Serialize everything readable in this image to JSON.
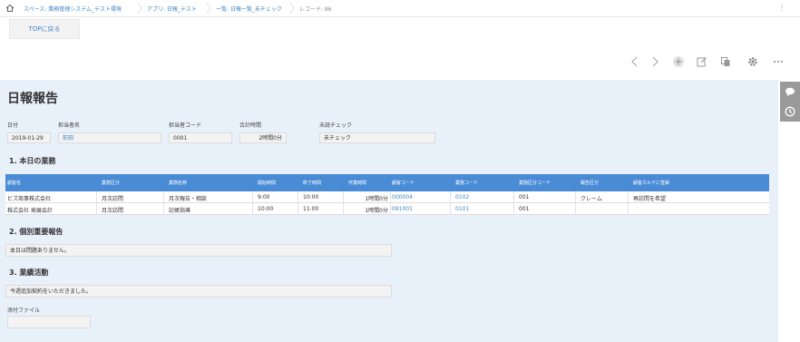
{
  "breadcrumb": {
    "space": "スペース: 業務管理システム_テスト環境",
    "app": "アプリ: 日報_テスト",
    "view": "一覧: 日報一覧_未チェック",
    "record": "レコード: 86"
  },
  "back_button": "TOPに戻る",
  "title": "日報報告",
  "fields": {
    "date": {
      "label": "日付",
      "value": "2019-01-29"
    },
    "person": {
      "label": "担当者名",
      "value": "前田"
    },
    "person_code": {
      "label": "担当者コード",
      "value": "0001"
    },
    "total_time": {
      "label": "合計時間",
      "value": "2時間0分"
    },
    "unread_check": {
      "label": "未読チェック",
      "value": "未チェック"
    }
  },
  "section1": "1. 本日の業務",
  "table": {
    "headers": [
      "顧客名",
      "業務区分",
      "業務名称",
      "開始時間",
      "終了時間",
      "作業時間",
      "顧客コード",
      "業務コード",
      "業務区分コード",
      "報告区分",
      "顧客カルテに登録"
    ],
    "rows": [
      [
        "ビズ商事株式会社",
        "月次訪問",
        "月次報告・相談",
        "9:00",
        "10:00",
        "1時間0分",
        "000004",
        "0102",
        "001",
        "クレーム",
        "再訪問を希望"
      ],
      [
        "株式会社 発展会計",
        "月次訪問",
        "記帳指導",
        "10:00",
        "11:00",
        "1時間0分",
        "091001",
        "0101",
        "001",
        "",
        ""
      ]
    ]
  },
  "section2": "2. 個別重要報告",
  "report_text": "本日は問題ありません。",
  "section3": "3. 業績活動",
  "activity_text": "今週追加契約をいただきました。",
  "attachment_label": "添付ファイル",
  "colors": {
    "accent": "#4a8bd6",
    "link": "#3f86c6",
    "content_bg": "#e8f0f9"
  },
  "icons": [
    "home-icon",
    "chevron-left-icon",
    "chevron-right-icon",
    "plus-icon",
    "edit-icon",
    "copy-icon",
    "gear-icon",
    "more-icon",
    "comment-icon",
    "history-icon"
  ]
}
